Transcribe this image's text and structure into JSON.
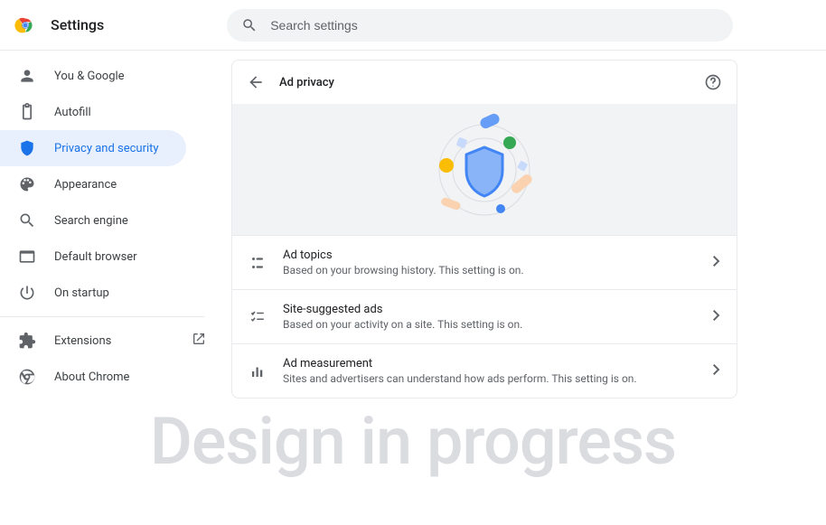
{
  "header": {
    "title": "Settings"
  },
  "search": {
    "placeholder": "Search settings"
  },
  "sidebar": {
    "items": [
      {
        "label": "You & Google"
      },
      {
        "label": "Autofill"
      },
      {
        "label": "Privacy and security"
      },
      {
        "label": "Appearance"
      },
      {
        "label": "Search engine"
      },
      {
        "label": "Default browser"
      },
      {
        "label": "On startup"
      },
      {
        "label": "Extensions"
      },
      {
        "label": "About Chrome"
      }
    ]
  },
  "panel": {
    "title": "Ad privacy",
    "rows": [
      {
        "title": "Ad topics",
        "desc": "Based on your browsing history. This setting is on."
      },
      {
        "title": "Site-suggested ads",
        "desc": "Based on your activity on a site. This setting is on."
      },
      {
        "title": "Ad measurement",
        "desc": "Sites and advertisers can understand how ads perform. This setting is on."
      }
    ]
  },
  "watermark": "Design in progress"
}
